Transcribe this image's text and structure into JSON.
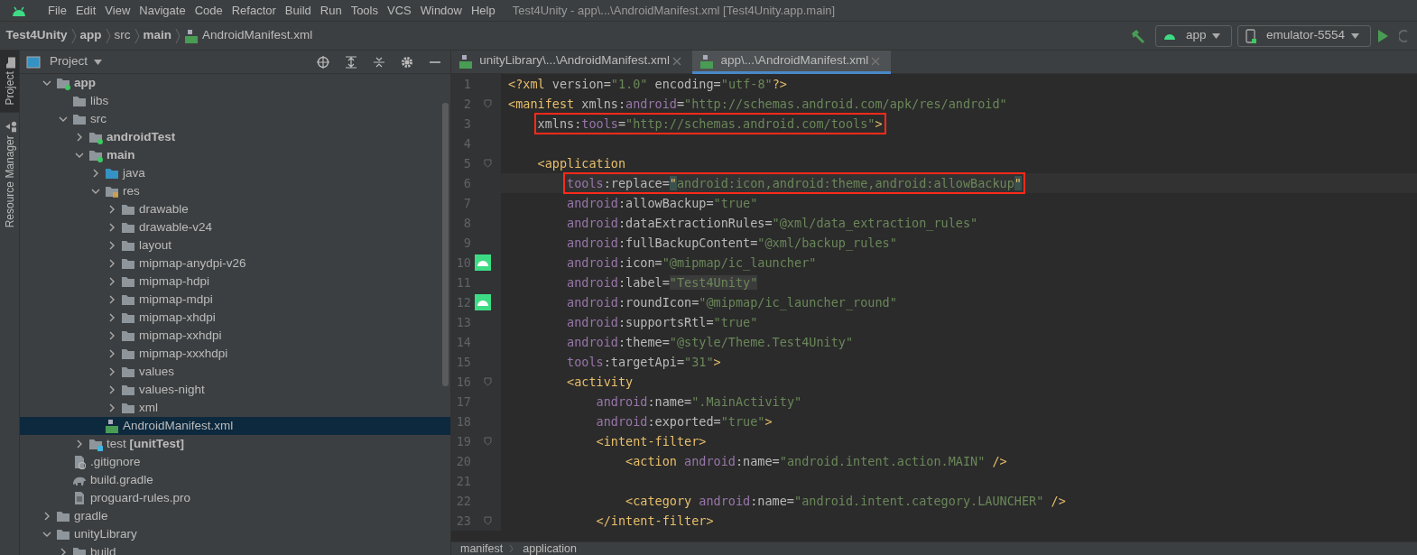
{
  "menu": [
    "File",
    "Edit",
    "View",
    "Navigate",
    "Code",
    "Refactor",
    "Build",
    "Run",
    "Tools",
    "VCS",
    "Window",
    "Help"
  ],
  "window": {
    "title": "Test4Unity - app\\...\\AndroidManifest.xml [Test4Unity.app.main]"
  },
  "breadcrumbs": [
    {
      "label": "Test4Unity",
      "bold": true,
      "kind": "text"
    },
    {
      "label": "app",
      "bold": true,
      "kind": "text"
    },
    {
      "label": "src",
      "bold": false,
      "kind": "text"
    },
    {
      "label": "main",
      "bold": true,
      "kind": "text"
    },
    {
      "label": "AndroidManifest.xml",
      "bold": false,
      "kind": "manifest"
    }
  ],
  "toolbar": {
    "run_config": "app",
    "device": "emulator-5554"
  },
  "tool_stripe": [
    {
      "label": "Project",
      "selected": true,
      "kind": "folder"
    },
    {
      "label": "Resource Manager",
      "selected": false,
      "kind": "shapes"
    }
  ],
  "project_panel": {
    "title": "Project",
    "tree": [
      {
        "label": "app",
        "bold": true,
        "kind": "module",
        "expanded": true,
        "selected": false,
        "children": [
          {
            "label": "libs",
            "kind": "folder",
            "selected": false
          },
          {
            "label": "src",
            "kind": "folder",
            "expanded": true,
            "selected": false,
            "children": [
              {
                "label": "androidTest",
                "bold": true,
                "kind": "module",
                "expanded": false,
                "selected": false
              },
              {
                "label": "main",
                "bold": true,
                "kind": "module",
                "expanded": true,
                "selected": false,
                "children": [
                  {
                    "label": "java",
                    "kind": "java",
                    "expanded": false,
                    "selected": false
                  },
                  {
                    "label": "res",
                    "kind": "res",
                    "expanded": true,
                    "selected": false,
                    "children": [
                      {
                        "label": "drawable",
                        "kind": "folder",
                        "expanded": false,
                        "selected": false
                      },
                      {
                        "label": "drawable-v24",
                        "kind": "folder",
                        "expanded": false,
                        "selected": false
                      },
                      {
                        "label": "layout",
                        "kind": "folder",
                        "expanded": false,
                        "selected": false
                      },
                      {
                        "label": "mipmap-anydpi-v26",
                        "kind": "folder",
                        "expanded": false,
                        "selected": false
                      },
                      {
                        "label": "mipmap-hdpi",
                        "kind": "folder",
                        "expanded": false,
                        "selected": false
                      },
                      {
                        "label": "mipmap-mdpi",
                        "kind": "folder",
                        "expanded": false,
                        "selected": false
                      },
                      {
                        "label": "mipmap-xhdpi",
                        "kind": "folder",
                        "expanded": false,
                        "selected": false
                      },
                      {
                        "label": "mipmap-xxhdpi",
                        "kind": "folder",
                        "expanded": false,
                        "selected": false
                      },
                      {
                        "label": "mipmap-xxxhdpi",
                        "kind": "folder",
                        "expanded": false,
                        "selected": false
                      },
                      {
                        "label": "values",
                        "kind": "folder",
                        "expanded": false,
                        "selected": false
                      },
                      {
                        "label": "values-night",
                        "kind": "folder",
                        "expanded": false,
                        "selected": false
                      },
                      {
                        "label": "xml",
                        "kind": "folder",
                        "expanded": false,
                        "selected": false
                      }
                    ]
                  },
                  {
                    "label": "AndroidManifest.xml",
                    "kind": "manifest",
                    "selected": true
                  }
                ]
              },
              {
                "label": "test **[unitTest]**",
                "kind": "test",
                "expanded": false,
                "selected": false
              }
            ]
          },
          {
            "label": ".gitignore",
            "kind": "gitignore",
            "selected": false
          },
          {
            "label": "build.gradle",
            "kind": "gradle",
            "selected": false
          },
          {
            "label": "proguard-rules.pro",
            "kind": "file",
            "selected": false
          }
        ]
      },
      {
        "label": "gradle",
        "kind": "folder",
        "expanded": false,
        "selected": false
      },
      {
        "label": "unityLibrary",
        "kind": "folder",
        "expanded": true,
        "selected": false,
        "children": [
          {
            "label": "build",
            "kind": "folder",
            "expanded": false,
            "selected": false
          }
        ]
      }
    ]
  },
  "tabs": [
    {
      "label": "unityLibrary\\...\\AndroidManifest.xml",
      "selected": false
    },
    {
      "label": "app\\...\\AndroidManifest.xml",
      "selected": true
    }
  ],
  "code": [
    {
      "n": "1",
      "tokens": [
        {
          "kind": "tag",
          "text": "<?xml "
        },
        {
          "kind": "attr",
          "text": "version="
        },
        {
          "kind": "value",
          "text": "\"1.0\" "
        },
        {
          "kind": "attr",
          "text": "encoding="
        },
        {
          "kind": "value",
          "text": "\"utf-8\""
        },
        {
          "kind": "tag",
          "text": "?>"
        }
      ]
    },
    {
      "n": "2",
      "fold": true,
      "tokens": [
        {
          "kind": "tag",
          "text": "<manifest "
        },
        {
          "kind": "attr",
          "text": "xmlns:"
        },
        {
          "kind": "ns",
          "text": "android"
        },
        {
          "kind": "attr",
          "text": "="
        },
        {
          "kind": "value",
          "text": "\"http://schemas.android.com/apk/res/android\""
        }
      ]
    },
    {
      "n": "3",
      "highlight": true,
      "tokens": [
        {
          "kind": "attr",
          "text": "    xmlns:"
        },
        {
          "kind": "ns",
          "text": "tools"
        },
        {
          "kind": "attr",
          "text": "="
        },
        {
          "kind": "value",
          "text": "\"http://schemas.android.com/tools\""
        },
        {
          "kind": "tag",
          "text": ">"
        }
      ]
    },
    {
      "n": "4"
    },
    {
      "n": "5",
      "fold": true,
      "tokens": [
        {
          "kind": "tag",
          "text": "    <application"
        }
      ]
    },
    {
      "n": "6",
      "current": true,
      "highlight": true,
      "tokens": [
        {
          "kind": "ns",
          "text": "        tools"
        },
        {
          "kind": "attr",
          "text": ":replace="
        },
        {
          "kind": "match",
          "text": "\""
        },
        {
          "kind": "value",
          "text": "android:icon,android:theme,android:allowBackup"
        },
        {
          "kind": "match",
          "text": "\""
        }
      ]
    },
    {
      "n": "7",
      "tokens": [
        {
          "kind": "ns",
          "text": "        android"
        },
        {
          "kind": "attr",
          "text": ":allowBackup="
        },
        {
          "kind": "value",
          "text": "\"true\""
        }
      ]
    },
    {
      "n": "8",
      "tokens": [
        {
          "kind": "ns",
          "text": "        android"
        },
        {
          "kind": "attr",
          "text": ":dataExtractionRules="
        },
        {
          "kind": "value",
          "text": "\"@xml/data_extraction_rules\""
        }
      ]
    },
    {
      "n": "9",
      "tokens": [
        {
          "kind": "ns",
          "text": "        android"
        },
        {
          "kind": "attr",
          "text": ":fullBackupContent="
        },
        {
          "kind": "value",
          "text": "\"@xml/backup_rules\""
        }
      ]
    },
    {
      "n": "10",
      "gutter_icon": true,
      "tokens": [
        {
          "kind": "ns",
          "text": "        android"
        },
        {
          "kind": "attr",
          "text": ":icon="
        },
        {
          "kind": "value",
          "text": "\"@mipmap/ic_launcher\""
        }
      ]
    },
    {
      "n": "11",
      "tokens": [
        {
          "kind": "ns",
          "text": "        android"
        },
        {
          "kind": "attr",
          "text": ":label="
        },
        {
          "kind": "value-marked",
          "text": "\"Test4Unity\""
        }
      ]
    },
    {
      "n": "12",
      "gutter_icon": true,
      "tokens": [
        {
          "kind": "ns",
          "text": "        android"
        },
        {
          "kind": "attr",
          "text": ":roundIcon="
        },
        {
          "kind": "value",
          "text": "\"@mipmap/ic_launcher_round\""
        }
      ]
    },
    {
      "n": "13",
      "tokens": [
        {
          "kind": "ns",
          "text": "        android"
        },
        {
          "kind": "attr",
          "text": ":supportsRtl="
        },
        {
          "kind": "value",
          "text": "\"true\""
        }
      ]
    },
    {
      "n": "14",
      "tokens": [
        {
          "kind": "ns",
          "text": "        android"
        },
        {
          "kind": "attr",
          "text": ":theme="
        },
        {
          "kind": "value",
          "text": "\"@style/Theme.Test4Unity\""
        }
      ]
    },
    {
      "n": "15",
      "tokens": [
        {
          "kind": "ns",
          "text": "        tools"
        },
        {
          "kind": "attr",
          "text": ":targetApi="
        },
        {
          "kind": "value",
          "text": "\"31\""
        },
        {
          "kind": "tag",
          "text": ">"
        }
      ]
    },
    {
      "n": "16",
      "fold": true,
      "tokens": [
        {
          "kind": "tag",
          "text": "        <activity"
        }
      ]
    },
    {
      "n": "17",
      "tokens": [
        {
          "kind": "ns",
          "text": "            android"
        },
        {
          "kind": "attr",
          "text": ":name="
        },
        {
          "kind": "value",
          "text": "\".MainActivity\""
        }
      ]
    },
    {
      "n": "18",
      "tokens": [
        {
          "kind": "ns",
          "text": "            android"
        },
        {
          "kind": "attr",
          "text": ":exported="
        },
        {
          "kind": "value",
          "text": "\"true\""
        },
        {
          "kind": "tag",
          "text": ">"
        }
      ]
    },
    {
      "n": "19",
      "fold": true,
      "tokens": [
        {
          "kind": "tag",
          "text": "            <intent-filter>"
        }
      ]
    },
    {
      "n": "20",
      "tokens": [
        {
          "kind": "tag",
          "text": "                <action "
        },
        {
          "kind": "ns",
          "text": "android"
        },
        {
          "kind": "attr",
          "text": ":name="
        },
        {
          "kind": "value",
          "text": "\"android.intent.action.MAIN\" "
        },
        {
          "kind": "tag",
          "text": "/>"
        }
      ]
    },
    {
      "n": "21"
    },
    {
      "n": "22",
      "tokens": [
        {
          "kind": "tag",
          "text": "                <category "
        },
        {
          "kind": "ns",
          "text": "android"
        },
        {
          "kind": "attr",
          "text": ":name="
        },
        {
          "kind": "value",
          "text": "\"android.intent.category.LAUNCHER\" "
        },
        {
          "kind": "tag",
          "text": "/>"
        }
      ]
    },
    {
      "n": "23",
      "fold": true,
      "tokens": [
        {
          "kind": "tag",
          "text": "            </intent-filter>"
        }
      ]
    }
  ],
  "editor_breadcrumbs": [
    "manifest",
    "application"
  ]
}
